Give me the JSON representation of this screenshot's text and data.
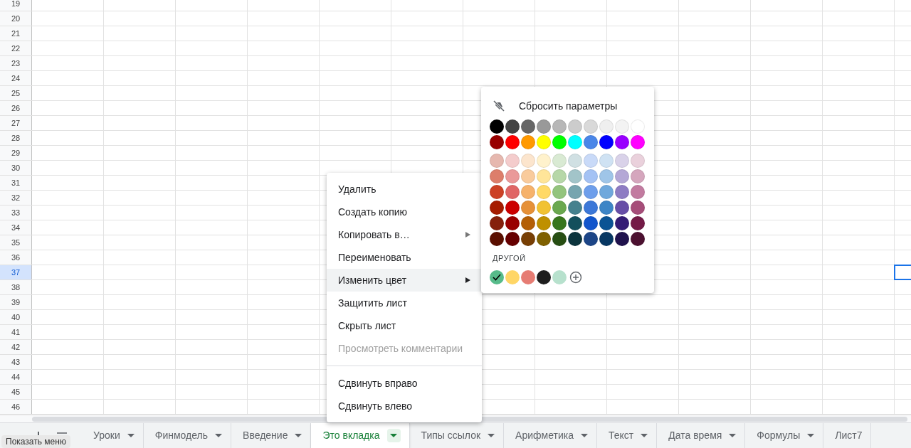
{
  "rows": [
    {
      "label": "19",
      "selected": false
    },
    {
      "label": "20",
      "selected": false
    },
    {
      "label": "21",
      "selected": false
    },
    {
      "label": "22",
      "selected": false
    },
    {
      "label": "23",
      "selected": false
    },
    {
      "label": "24",
      "selected": false
    },
    {
      "label": "25",
      "selected": false
    },
    {
      "label": "26",
      "selected": false
    },
    {
      "label": "27",
      "selected": false
    },
    {
      "label": "28",
      "selected": false
    },
    {
      "label": "29",
      "selected": false
    },
    {
      "label": "30",
      "selected": false
    },
    {
      "label": "31",
      "selected": false
    },
    {
      "label": "32",
      "selected": false
    },
    {
      "label": "33",
      "selected": false
    },
    {
      "label": "34",
      "selected": false
    },
    {
      "label": "35",
      "selected": false
    },
    {
      "label": "36",
      "selected": false
    },
    {
      "label": "37",
      "selected": true
    },
    {
      "label": "38",
      "selected": false
    },
    {
      "label": "39",
      "selected": false
    },
    {
      "label": "40",
      "selected": false
    },
    {
      "label": "41",
      "selected": false
    },
    {
      "label": "42",
      "selected": false
    },
    {
      "label": "43",
      "selected": false
    },
    {
      "label": "44",
      "selected": false
    },
    {
      "label": "45",
      "selected": false
    },
    {
      "label": "46",
      "selected": false
    }
  ],
  "tooltip": "Показать меню",
  "tabs": [
    {
      "label": "Уроки",
      "selected": false,
      "dropdown": true
    },
    {
      "label": "Финмодель",
      "selected": false,
      "dropdown": true
    },
    {
      "label": "Введение",
      "selected": false,
      "dropdown": true
    },
    {
      "label": "Это вкладка",
      "selected": true,
      "dropdown": true
    },
    {
      "label": "Типы ссылок",
      "selected": false,
      "dropdown": true
    },
    {
      "label": "Арифметика",
      "selected": false,
      "dropdown": true
    },
    {
      "label": "Текст",
      "selected": false,
      "dropdown": true
    },
    {
      "label": "Дата время",
      "selected": false,
      "dropdown": true
    },
    {
      "label": "Формулы",
      "selected": false,
      "dropdown": true
    },
    {
      "label": "Лист7",
      "selected": false,
      "dropdown": false
    }
  ],
  "context_menu": {
    "groups": [
      [
        {
          "label": "Удалить",
          "submenu": false,
          "highlighted": false,
          "disabled": false
        },
        {
          "label": "Создать копию",
          "submenu": false,
          "highlighted": false,
          "disabled": false
        },
        {
          "label": "Копировать в…",
          "submenu": true,
          "highlighted": false,
          "disabled": false
        },
        {
          "label": "Переименовать",
          "submenu": false,
          "highlighted": false,
          "disabled": false
        },
        {
          "label": "Изменить цвет",
          "submenu": true,
          "highlighted": true,
          "disabled": false
        },
        {
          "label": "Защитить лист",
          "submenu": false,
          "highlighted": false,
          "disabled": false
        },
        {
          "label": "Скрыть лист",
          "submenu": false,
          "highlighted": false,
          "disabled": false
        },
        {
          "label": "Просмотреть комментарии",
          "submenu": false,
          "highlighted": false,
          "disabled": true
        }
      ],
      [
        {
          "label": "Сдвинуть вправо",
          "submenu": false,
          "highlighted": false,
          "disabled": false
        },
        {
          "label": "Сдвинуть влево",
          "submenu": false,
          "highlighted": false,
          "disabled": false
        }
      ]
    ]
  },
  "color_menu": {
    "reset_label": "Сбросить параметры",
    "palette": [
      [
        {
          "color": "#000000"
        },
        {
          "color": "#434343"
        },
        {
          "color": "#666666"
        },
        {
          "color": "#999999"
        },
        {
          "color": "#b7b7b7"
        },
        {
          "color": "#cccccc"
        },
        {
          "color": "#d9d9d9"
        },
        {
          "color": "#efefef"
        },
        {
          "color": "#f3f3f3"
        },
        {
          "color": "#ffffff"
        }
      ],
      [
        {
          "color": "#980000"
        },
        {
          "color": "#ff0000"
        },
        {
          "color": "#ff9900"
        },
        {
          "color": "#ffff00"
        },
        {
          "color": "#00ff00"
        },
        {
          "color": "#00ffff"
        },
        {
          "color": "#4a86e8"
        },
        {
          "color": "#0000ff"
        },
        {
          "color": "#9900ff"
        },
        {
          "color": "#ff00ff"
        }
      ],
      [
        {
          "color": "#e6b8af"
        },
        {
          "color": "#f4cccc"
        },
        {
          "color": "#fce5cd"
        },
        {
          "color": "#fff2cc"
        },
        {
          "color": "#d9ead3"
        },
        {
          "color": "#d0e0e3"
        },
        {
          "color": "#c9daf8"
        },
        {
          "color": "#cfe2f3"
        },
        {
          "color": "#d9d2e9"
        },
        {
          "color": "#ead1dc"
        }
      ],
      [
        {
          "color": "#dd7e6b"
        },
        {
          "color": "#ea9999"
        },
        {
          "color": "#f9cb9c"
        },
        {
          "color": "#ffe599"
        },
        {
          "color": "#b6d7a8"
        },
        {
          "color": "#a2c4c9"
        },
        {
          "color": "#a4c2f4"
        },
        {
          "color": "#9fc5e8"
        },
        {
          "color": "#b4a7d6"
        },
        {
          "color": "#d5a6bd"
        }
      ],
      [
        {
          "color": "#cc4125"
        },
        {
          "color": "#e06666"
        },
        {
          "color": "#f6b26b"
        },
        {
          "color": "#ffd966"
        },
        {
          "color": "#93c47d"
        },
        {
          "color": "#76a5af"
        },
        {
          "color": "#6d9eeb"
        },
        {
          "color": "#6fa8dc"
        },
        {
          "color": "#8e7cc3"
        },
        {
          "color": "#c27ba0"
        }
      ],
      [
        {
          "color": "#a61c00"
        },
        {
          "color": "#cc0000"
        },
        {
          "color": "#e69138"
        },
        {
          "color": "#f1c232"
        },
        {
          "color": "#6aa84f"
        },
        {
          "color": "#45818e"
        },
        {
          "color": "#3c78d8"
        },
        {
          "color": "#3d85c6"
        },
        {
          "color": "#674ea7"
        },
        {
          "color": "#a64d79"
        }
      ],
      [
        {
          "color": "#85200c"
        },
        {
          "color": "#990000"
        },
        {
          "color": "#b45f06"
        },
        {
          "color": "#bf9000"
        },
        {
          "color": "#38761d"
        },
        {
          "color": "#134f5c"
        },
        {
          "color": "#1155cc"
        },
        {
          "color": "#0b5394"
        },
        {
          "color": "#351c75"
        },
        {
          "color": "#741b47"
        }
      ],
      [
        {
          "color": "#5b0f00"
        },
        {
          "color": "#660000"
        },
        {
          "color": "#783f04"
        },
        {
          "color": "#7f6000"
        },
        {
          "color": "#274e13"
        },
        {
          "color": "#0c343d"
        },
        {
          "color": "#1c4587"
        },
        {
          "color": "#073763"
        },
        {
          "color": "#20124d"
        },
        {
          "color": "#4c1130"
        }
      ]
    ],
    "custom_label": "ДРУГОЙ",
    "custom": [
      {
        "color": "#57bb8a",
        "selected": true
      },
      {
        "color": "#ffd666",
        "selected": false
      },
      {
        "color": "#e67c73",
        "selected": false
      },
      {
        "color": "#1e1e1e",
        "selected": false
      },
      {
        "color": "#b7e1cd",
        "selected": false
      }
    ]
  }
}
